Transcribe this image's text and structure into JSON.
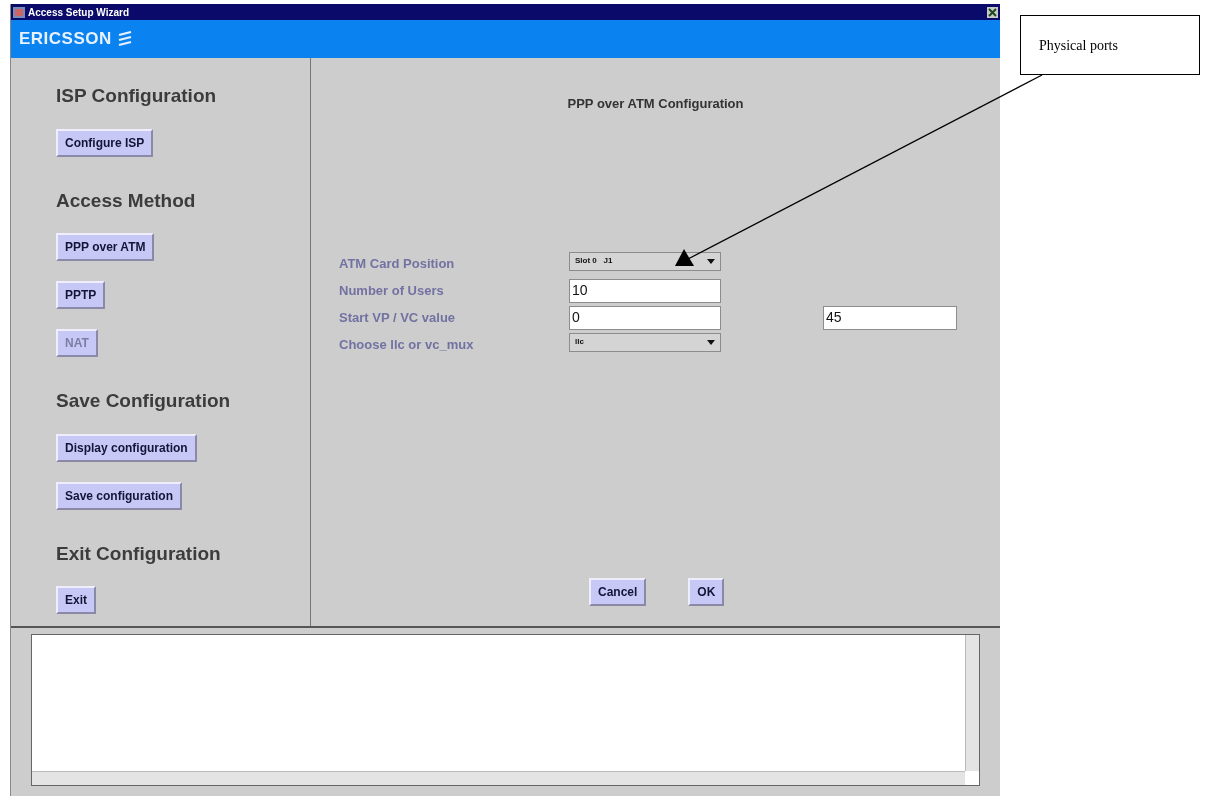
{
  "window": {
    "title": "Access Setup Wizard"
  },
  "banner": {
    "brand": "ERICSSON"
  },
  "sidebar": {
    "sections": [
      {
        "heading": "ISP Configuration",
        "buttons": [
          {
            "label": "Configure ISP",
            "disabled": false
          }
        ]
      },
      {
        "heading": "Access Method",
        "buttons": [
          {
            "label": "PPP over ATM",
            "disabled": false
          },
          {
            "label": "PPTP",
            "disabled": false
          },
          {
            "label": "NAT",
            "disabled": true
          }
        ]
      },
      {
        "heading": "Save Configuration",
        "buttons": [
          {
            "label": "Display configuration",
            "disabled": false
          },
          {
            "label": "Save configuration",
            "disabled": false
          }
        ]
      },
      {
        "heading": "Exit Configuration",
        "buttons": [
          {
            "label": "Exit",
            "disabled": false
          }
        ]
      }
    ]
  },
  "form": {
    "title": "PPP over ATM Configuration",
    "rows": [
      {
        "label": "ATM Card Position",
        "fields": [
          {
            "kind": "dropdown",
            "value": "Slot 0   J1"
          }
        ]
      },
      {
        "label": "Number of Users",
        "fields": [
          {
            "kind": "text",
            "value": "10"
          }
        ]
      },
      {
        "label": "Start VP / VC value",
        "fields": [
          {
            "kind": "text",
            "value": "0"
          },
          {
            "kind": "text",
            "value": "45"
          }
        ]
      },
      {
        "label": "Choose llc or vc_mux",
        "fields": [
          {
            "kind": "dropdown",
            "value": "llc"
          }
        ]
      }
    ]
  },
  "buttons": [
    {
      "label": "Cancel"
    },
    {
      "label": "OK"
    }
  ],
  "annotation": {
    "text": "Physical ports"
  }
}
